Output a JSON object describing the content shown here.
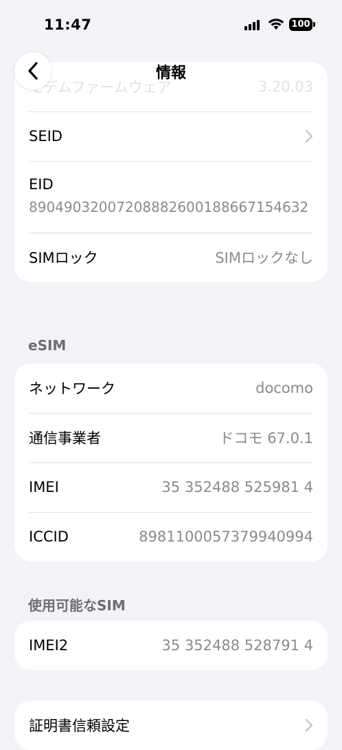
{
  "status": {
    "time": "11:47",
    "battery": "100"
  },
  "nav": {
    "title": "情報"
  },
  "group1": {
    "modem": {
      "label": "モデムファームウェア",
      "value": "3.20.03"
    },
    "seid": {
      "label": "SEID"
    },
    "eid": {
      "label": "EID",
      "value": "89049032007208882600188667154632"
    },
    "simlock": {
      "label": "SIMロック",
      "value": "SIMロックなし"
    }
  },
  "esim": {
    "header": "eSIM",
    "network": {
      "label": "ネットワーク",
      "value": "docomo"
    },
    "carrier": {
      "label": "通信事業者",
      "value": "ドコモ 67.0.1"
    },
    "imei": {
      "label": "IMEI",
      "value": "35 352488 525981 4"
    },
    "iccid": {
      "label": "ICCID",
      "value": "8981100057379940994"
    }
  },
  "available_sim": {
    "header": "使用可能なSIM",
    "imei2": {
      "label": "IMEI2",
      "value": "35 352488 528791 4"
    }
  },
  "certificates": {
    "label": "証明書信頼設定"
  }
}
